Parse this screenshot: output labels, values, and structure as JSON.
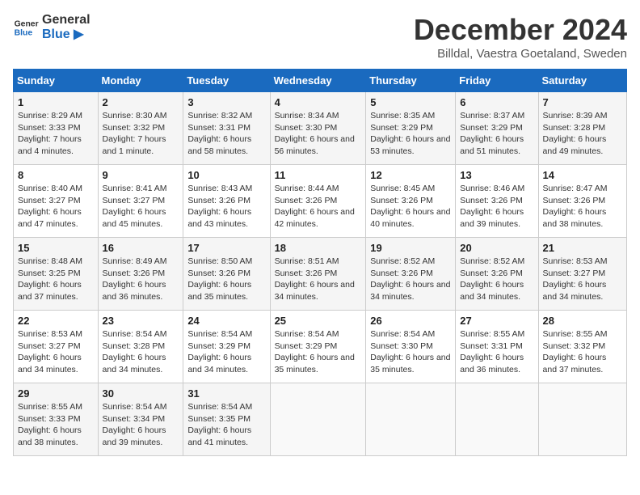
{
  "logo": {
    "text_general": "General",
    "text_blue": "Blue"
  },
  "header": {
    "month": "December 2024",
    "location": "Billdal, Vaestra Goetaland, Sweden"
  },
  "weekdays": [
    "Sunday",
    "Monday",
    "Tuesday",
    "Wednesday",
    "Thursday",
    "Friday",
    "Saturday"
  ],
  "weeks": [
    [
      {
        "day": "1",
        "sunrise": "Sunrise: 8:29 AM",
        "sunset": "Sunset: 3:33 PM",
        "daylight": "Daylight: 7 hours and 4 minutes."
      },
      {
        "day": "2",
        "sunrise": "Sunrise: 8:30 AM",
        "sunset": "Sunset: 3:32 PM",
        "daylight": "Daylight: 7 hours and 1 minute."
      },
      {
        "day": "3",
        "sunrise": "Sunrise: 8:32 AM",
        "sunset": "Sunset: 3:31 PM",
        "daylight": "Daylight: 6 hours and 58 minutes."
      },
      {
        "day": "4",
        "sunrise": "Sunrise: 8:34 AM",
        "sunset": "Sunset: 3:30 PM",
        "daylight": "Daylight: 6 hours and 56 minutes."
      },
      {
        "day": "5",
        "sunrise": "Sunrise: 8:35 AM",
        "sunset": "Sunset: 3:29 PM",
        "daylight": "Daylight: 6 hours and 53 minutes."
      },
      {
        "day": "6",
        "sunrise": "Sunrise: 8:37 AM",
        "sunset": "Sunset: 3:29 PM",
        "daylight": "Daylight: 6 hours and 51 minutes."
      },
      {
        "day": "7",
        "sunrise": "Sunrise: 8:39 AM",
        "sunset": "Sunset: 3:28 PM",
        "daylight": "Daylight: 6 hours and 49 minutes."
      }
    ],
    [
      {
        "day": "8",
        "sunrise": "Sunrise: 8:40 AM",
        "sunset": "Sunset: 3:27 PM",
        "daylight": "Daylight: 6 hours and 47 minutes."
      },
      {
        "day": "9",
        "sunrise": "Sunrise: 8:41 AM",
        "sunset": "Sunset: 3:27 PM",
        "daylight": "Daylight: 6 hours and 45 minutes."
      },
      {
        "day": "10",
        "sunrise": "Sunrise: 8:43 AM",
        "sunset": "Sunset: 3:26 PM",
        "daylight": "Daylight: 6 hours and 43 minutes."
      },
      {
        "day": "11",
        "sunrise": "Sunrise: 8:44 AM",
        "sunset": "Sunset: 3:26 PM",
        "daylight": "Daylight: 6 hours and 42 minutes."
      },
      {
        "day": "12",
        "sunrise": "Sunrise: 8:45 AM",
        "sunset": "Sunset: 3:26 PM",
        "daylight": "Daylight: 6 hours and 40 minutes."
      },
      {
        "day": "13",
        "sunrise": "Sunrise: 8:46 AM",
        "sunset": "Sunset: 3:26 PM",
        "daylight": "Daylight: 6 hours and 39 minutes."
      },
      {
        "day": "14",
        "sunrise": "Sunrise: 8:47 AM",
        "sunset": "Sunset: 3:26 PM",
        "daylight": "Daylight: 6 hours and 38 minutes."
      }
    ],
    [
      {
        "day": "15",
        "sunrise": "Sunrise: 8:48 AM",
        "sunset": "Sunset: 3:25 PM",
        "daylight": "Daylight: 6 hours and 37 minutes."
      },
      {
        "day": "16",
        "sunrise": "Sunrise: 8:49 AM",
        "sunset": "Sunset: 3:26 PM",
        "daylight": "Daylight: 6 hours and 36 minutes."
      },
      {
        "day": "17",
        "sunrise": "Sunrise: 8:50 AM",
        "sunset": "Sunset: 3:26 PM",
        "daylight": "Daylight: 6 hours and 35 minutes."
      },
      {
        "day": "18",
        "sunrise": "Sunrise: 8:51 AM",
        "sunset": "Sunset: 3:26 PM",
        "daylight": "Daylight: 6 hours and 34 minutes."
      },
      {
        "day": "19",
        "sunrise": "Sunrise: 8:52 AM",
        "sunset": "Sunset: 3:26 PM",
        "daylight": "Daylight: 6 hours and 34 minutes."
      },
      {
        "day": "20",
        "sunrise": "Sunrise: 8:52 AM",
        "sunset": "Sunset: 3:26 PM",
        "daylight": "Daylight: 6 hours and 34 minutes."
      },
      {
        "day": "21",
        "sunrise": "Sunrise: 8:53 AM",
        "sunset": "Sunset: 3:27 PM",
        "daylight": "Daylight: 6 hours and 34 minutes."
      }
    ],
    [
      {
        "day": "22",
        "sunrise": "Sunrise: 8:53 AM",
        "sunset": "Sunset: 3:27 PM",
        "daylight": "Daylight: 6 hours and 34 minutes."
      },
      {
        "day": "23",
        "sunrise": "Sunrise: 8:54 AM",
        "sunset": "Sunset: 3:28 PM",
        "daylight": "Daylight: 6 hours and 34 minutes."
      },
      {
        "day": "24",
        "sunrise": "Sunrise: 8:54 AM",
        "sunset": "Sunset: 3:29 PM",
        "daylight": "Daylight: 6 hours and 34 minutes."
      },
      {
        "day": "25",
        "sunrise": "Sunrise: 8:54 AM",
        "sunset": "Sunset: 3:29 PM",
        "daylight": "Daylight: 6 hours and 35 minutes."
      },
      {
        "day": "26",
        "sunrise": "Sunrise: 8:54 AM",
        "sunset": "Sunset: 3:30 PM",
        "daylight": "Daylight: 6 hours and 35 minutes."
      },
      {
        "day": "27",
        "sunrise": "Sunrise: 8:55 AM",
        "sunset": "Sunset: 3:31 PM",
        "daylight": "Daylight: 6 hours and 36 minutes."
      },
      {
        "day": "28",
        "sunrise": "Sunrise: 8:55 AM",
        "sunset": "Sunset: 3:32 PM",
        "daylight": "Daylight: 6 hours and 37 minutes."
      }
    ],
    [
      {
        "day": "29",
        "sunrise": "Sunrise: 8:55 AM",
        "sunset": "Sunset: 3:33 PM",
        "daylight": "Daylight: 6 hours and 38 minutes."
      },
      {
        "day": "30",
        "sunrise": "Sunrise: 8:54 AM",
        "sunset": "Sunset: 3:34 PM",
        "daylight": "Daylight: 6 hours and 39 minutes."
      },
      {
        "day": "31",
        "sunrise": "Sunrise: 8:54 AM",
        "sunset": "Sunset: 3:35 PM",
        "daylight": "Daylight: 6 hours and 41 minutes."
      },
      {
        "day": "",
        "sunrise": "",
        "sunset": "",
        "daylight": ""
      },
      {
        "day": "",
        "sunrise": "",
        "sunset": "",
        "daylight": ""
      },
      {
        "day": "",
        "sunrise": "",
        "sunset": "",
        "daylight": ""
      },
      {
        "day": "",
        "sunrise": "",
        "sunset": "",
        "daylight": ""
      }
    ]
  ]
}
